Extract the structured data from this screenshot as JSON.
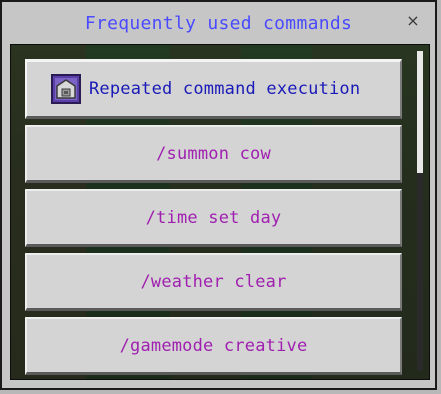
{
  "dialog": {
    "title": "Frequently used commands",
    "close_label": "×",
    "title_color": "#4a4aff"
  },
  "commands": [
    {
      "label": "Repeated command execution",
      "icon": "command-block-icon",
      "color": "#1a1ab8"
    },
    {
      "label": "/summon cow",
      "color": "#a020b0"
    },
    {
      "label": "/time set day",
      "color": "#a020b0"
    },
    {
      "label": "/weather clear",
      "color": "#a020b0"
    },
    {
      "label": "/gamemode creative",
      "color": "#a020b0"
    }
  ]
}
